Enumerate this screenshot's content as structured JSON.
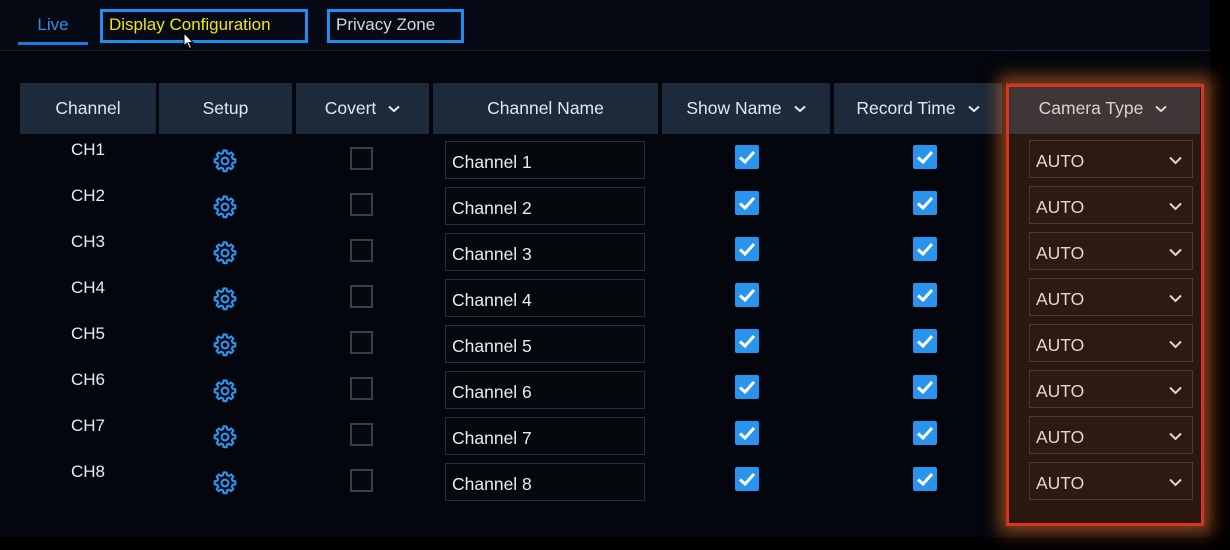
{
  "tabs": {
    "live": "Live",
    "display_configuration": "Display Configuration",
    "privacy_zone": "Privacy Zone"
  },
  "columns": {
    "channel": "Channel",
    "setup": "Setup",
    "covert": "Covert",
    "channel_name": "Channel Name",
    "show_name": "Show Name",
    "record_time": "Record Time",
    "camera_type": "Camera Type"
  },
  "rows": [
    {
      "channel": "CH1",
      "name": "Channel 1",
      "covert": false,
      "show_name": true,
      "record_time": true,
      "camera_type": "AUTO"
    },
    {
      "channel": "CH2",
      "name": "Channel 2",
      "covert": false,
      "show_name": true,
      "record_time": true,
      "camera_type": "AUTO"
    },
    {
      "channel": "CH3",
      "name": "Channel 3",
      "covert": false,
      "show_name": true,
      "record_time": true,
      "camera_type": "AUTO"
    },
    {
      "channel": "CH4",
      "name": "Channel 4",
      "covert": false,
      "show_name": true,
      "record_time": true,
      "camera_type": "AUTO"
    },
    {
      "channel": "CH5",
      "name": "Channel 5",
      "covert": false,
      "show_name": true,
      "record_time": true,
      "camera_type": "AUTO"
    },
    {
      "channel": "CH6",
      "name": "Channel 6",
      "covert": false,
      "show_name": true,
      "record_time": true,
      "camera_type": "AUTO"
    },
    {
      "channel": "CH7",
      "name": "Channel 7",
      "covert": false,
      "show_name": true,
      "record_time": true,
      "camera_type": "AUTO"
    },
    {
      "channel": "CH8",
      "name": "Channel 8",
      "covert": false,
      "show_name": true,
      "record_time": true,
      "camera_type": "AUTO"
    }
  ],
  "icons": {
    "setup": "gear-icon",
    "dropdown": "chevron-down-icon",
    "checked": "check-icon",
    "pointer": "mouse-cursor-icon"
  },
  "colors": {
    "accent": "#2894ee",
    "active_tab_text": "#f0e41a",
    "tab_border": "#1c8ff0",
    "header_bg": "#1c2a3b",
    "highlight": "#d8341e"
  }
}
